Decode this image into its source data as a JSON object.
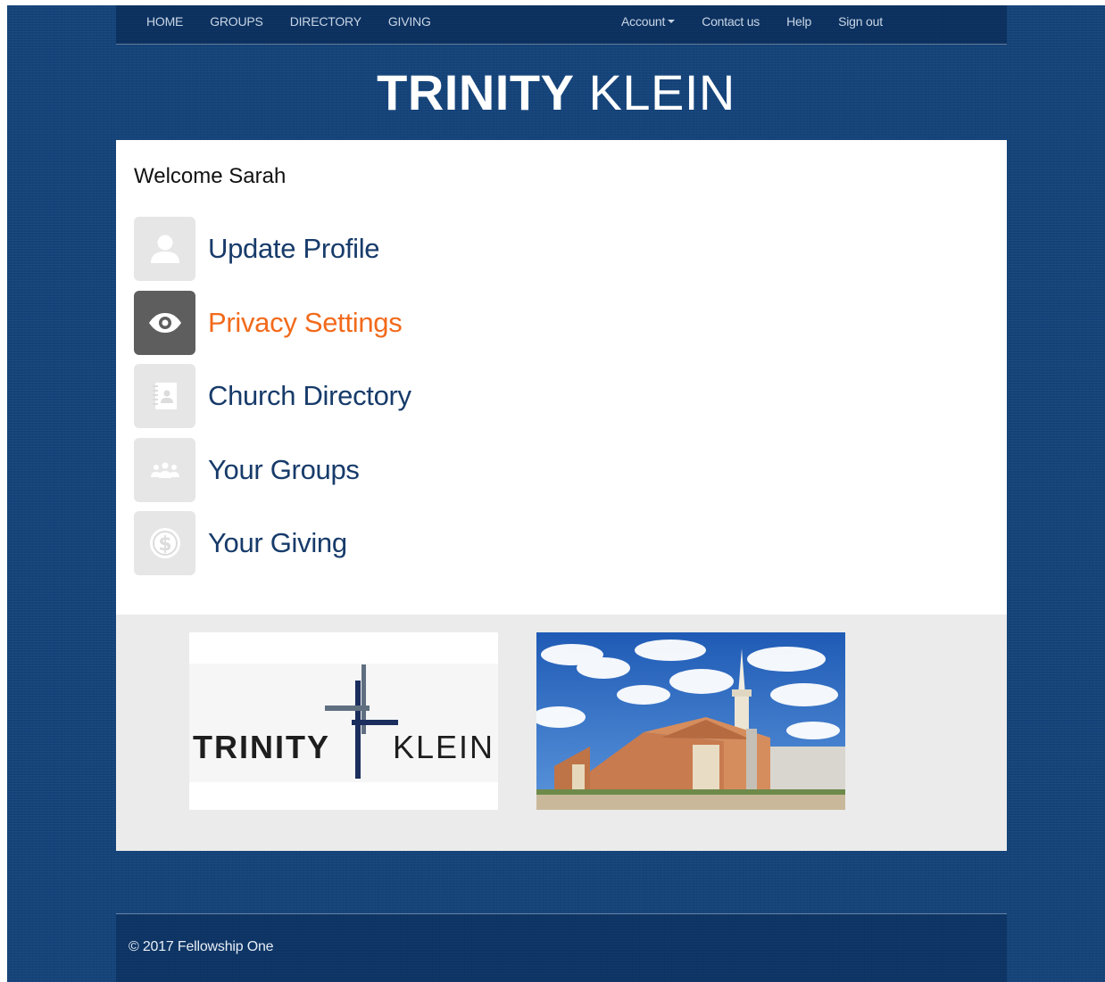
{
  "nav": {
    "left": [
      "HOME",
      "GROUPS",
      "DIRECTORY",
      "GIVING"
    ],
    "account_label": "Account",
    "right": [
      "Contact us",
      "Help",
      "Sign out"
    ]
  },
  "brand": {
    "bold": "TRINITY",
    "light": "KLEIN"
  },
  "welcome": "Welcome Sarah",
  "menu": [
    {
      "label": "Update Profile",
      "icon": "user-icon"
    },
    {
      "label": "Privacy Settings",
      "icon": "eye-icon",
      "active": true
    },
    {
      "label": "Church Directory",
      "icon": "address-book-icon"
    },
    {
      "label": "Your Groups",
      "icon": "group-icon"
    },
    {
      "label": "Your Giving",
      "icon": "dollar-coin-icon"
    }
  ],
  "logo_image": {
    "word_left": "TRINITY",
    "word_right": "KLEIN"
  },
  "footer": {
    "copyright": "© 2017 Fellowship One"
  },
  "colors": {
    "background": "#14437a",
    "link": "#173b6a",
    "active": "#f26a1b",
    "tile": "#e6e6e6",
    "tile_active": "#5e5e5e"
  }
}
